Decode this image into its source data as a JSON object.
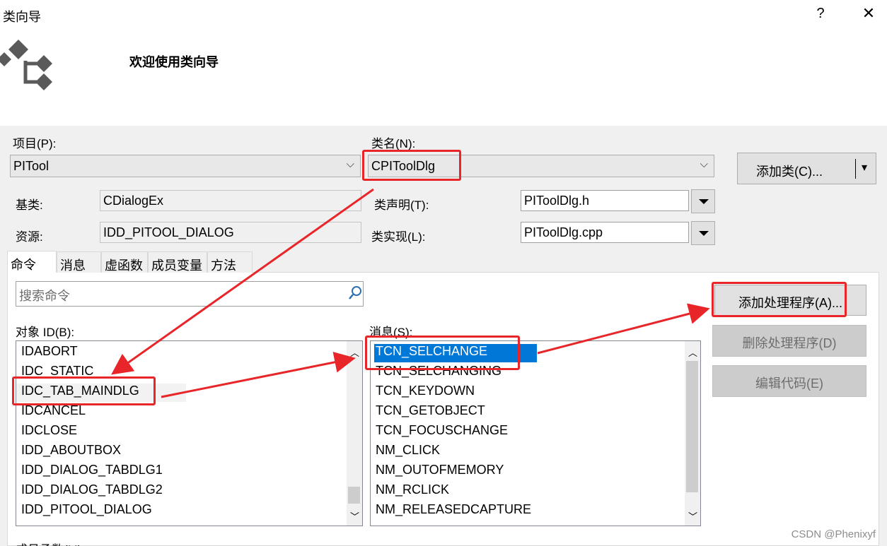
{
  "window": {
    "title": "类向导",
    "help": "?",
    "close": "✕"
  },
  "header": {
    "title": "欢迎使用类向导"
  },
  "project": {
    "label": "项目(P):",
    "value": "PITool"
  },
  "classname": {
    "label": "类名(N):",
    "value": "CPIToolDlg"
  },
  "add_class": {
    "label": "添加类(C)...",
    "arrow": "▾"
  },
  "base_class": {
    "label": "基类:",
    "value": "CDialogEx"
  },
  "resource": {
    "label": "资源:",
    "value": "IDD_PITOOL_DIALOG"
  },
  "class_decl": {
    "label": "类声明(T):",
    "value": "PIToolDlg.h"
  },
  "class_impl": {
    "label": "类实现(L):",
    "value": "PIToolDlg.cpp"
  },
  "tabs": [
    {
      "label": "命令"
    },
    {
      "label": "消息"
    },
    {
      "label": "虚函数"
    },
    {
      "label": "成员变量"
    },
    {
      "label": "方法"
    }
  ],
  "search": {
    "placeholder": "搜索命令"
  },
  "object_ids": {
    "label": "对象 ID(B):",
    "items": [
      "IDABORT",
      "IDC_STATIC",
      "IDC_TAB_MAINDLG",
      "IDCANCEL",
      "IDCLOSE",
      "IDD_ABOUTBOX",
      "IDD_DIALOG_TABDLG1",
      "IDD_DIALOG_TABDLG2",
      "IDD_PITOOL_DIALOG"
    ],
    "selected": "IDC_TAB_MAINDLG"
  },
  "messages": {
    "label": "消息(S):",
    "items": [
      "TCN_SELCHANGE",
      "TCN_SELCHANGING",
      "TCN_KEYDOWN",
      "TCN_GETOBJECT",
      "TCN_FOCUSCHANGE",
      "NM_CLICK",
      "NM_OUTOFMEMORY",
      "NM_RCLICK",
      "NM_RELEASEDCAPTURE"
    ],
    "selected": "TCN_SELCHANGE"
  },
  "buttons": {
    "add_handler": "添加处理程序(A)...",
    "delete_handler": "删除处理程序(D)",
    "edit_code": "编辑代码(E)"
  },
  "member_functions": {
    "label": "成员函数(M):"
  },
  "watermark": "CSDN @Phenixyf",
  "colors": {
    "annotation_red": "#e8262a",
    "selection_blue": "#0078d7",
    "panel_bg": "#f0f0f0"
  }
}
